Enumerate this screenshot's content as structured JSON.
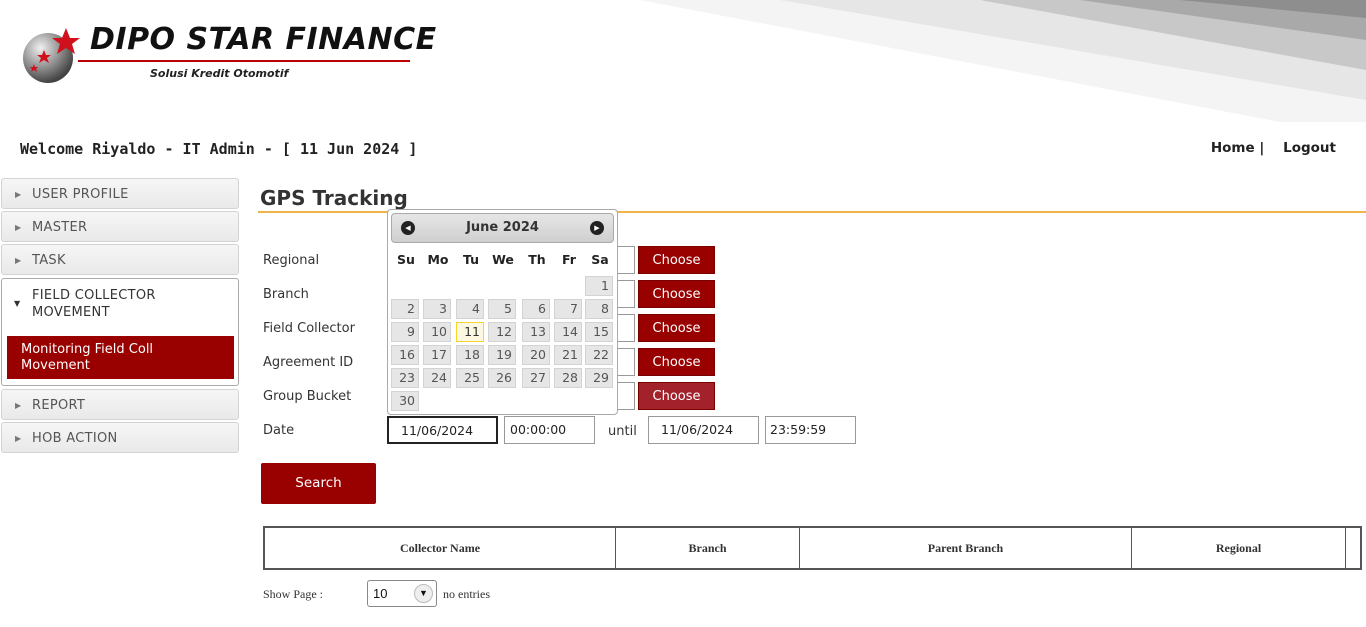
{
  "header": {
    "logo_name": "DIPO STAR FINANCE",
    "logo_tagline": "Solusi Kredit Otomotif",
    "welcome": "Welcome Riyaldo - IT Admin - [ 11 Jun 2024 ]",
    "home_link": "Home |",
    "logout_link": "Logout"
  },
  "sidebar": {
    "items": [
      {
        "label": "USER PROFILE"
      },
      {
        "label": "MASTER"
      },
      {
        "label": "TASK"
      },
      {
        "label": "FIELD COLLECTOR MOVEMENT"
      },
      {
        "label": "REPORT"
      },
      {
        "label": "HOB ACTION"
      }
    ],
    "submenu_item": "Monitoring Field Coll Movement"
  },
  "main": {
    "title": "GPS Tracking",
    "fields": {
      "regional": "Regional",
      "branch": "Branch",
      "field_collector": "Field Collector",
      "agreement_id": "Agreement ID",
      "group_bucket": "Group Bucket",
      "date": "Date"
    },
    "choose_label": "Choose",
    "date_from": "11/06/2024",
    "time_from": "00:00:00",
    "until": "until",
    "date_to": "11/06/2024",
    "time_to": "23:59:59",
    "search_label": "Search"
  },
  "table": {
    "columns": [
      "Collector Name",
      "Branch",
      "Parent Branch",
      "Regional"
    ]
  },
  "paging": {
    "show_page": "Show Page :",
    "page_size": "10",
    "no_entries": "no entries"
  },
  "datepicker": {
    "title": "June 2024",
    "weekdays": [
      "Su",
      "Mo",
      "Tu",
      "We",
      "Th",
      "Fr",
      "Sa"
    ],
    "today": 11,
    "first_weekday": 6,
    "days_in_month": 30
  },
  "colors": {
    "accent": "#990000",
    "title_rule": "#f0b44d"
  }
}
